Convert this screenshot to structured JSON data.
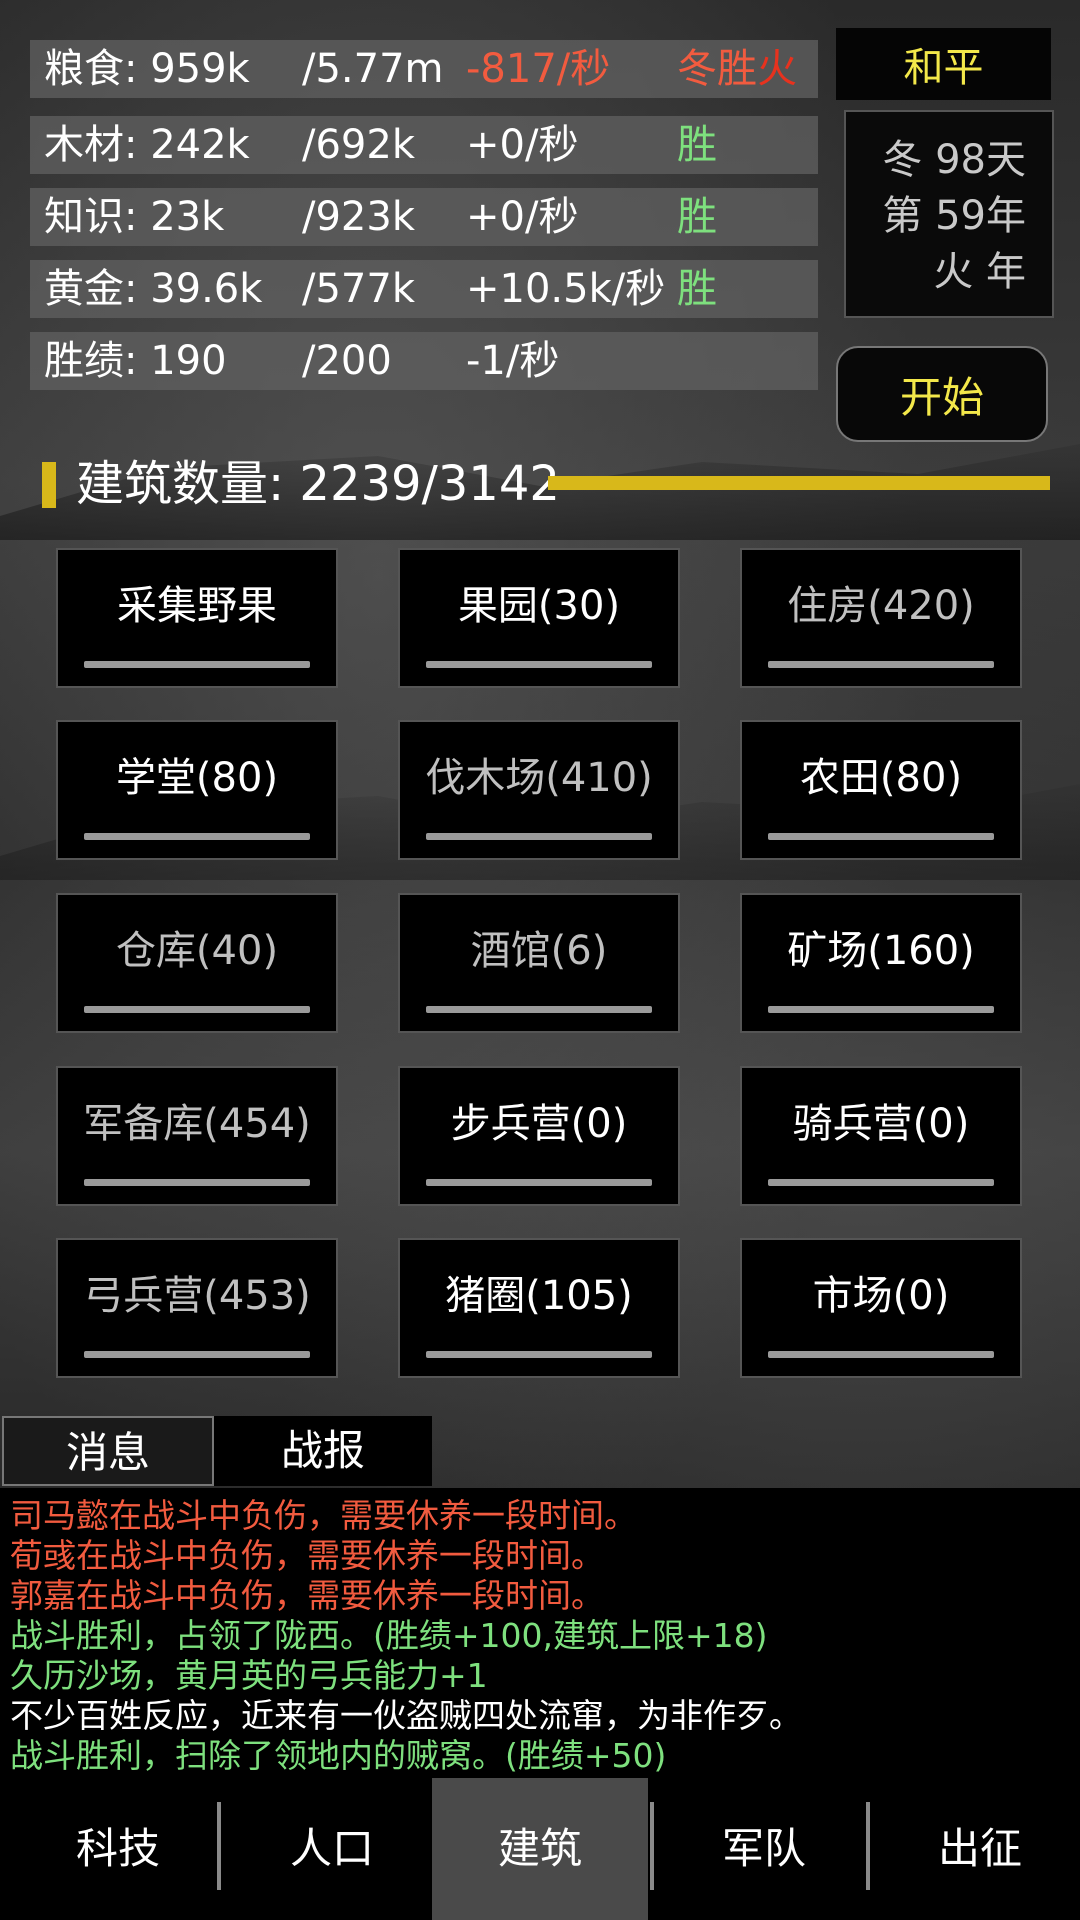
{
  "colors": {
    "red": "#f25b3f",
    "green": "#7ee07e",
    "yellow": "#f3e84a",
    "white": "#ffffff",
    "gray": "#c0c0c0"
  },
  "resources": [
    {
      "name": "粮食: 959k",
      "max": "/5.77m",
      "rate": "-817/秒",
      "tag": "冬胜",
      "tag_extra": "火"
    },
    {
      "name": "木材: 242k",
      "max": "/692k",
      "rate": "+0/秒",
      "tag": "胜",
      "tag_extra": ""
    },
    {
      "name": "知识: 23k",
      "max": "/923k",
      "rate": "+0/秒",
      "tag": "胜",
      "tag_extra": ""
    },
    {
      "name": "黄金: 39.6k",
      "max": "/577k",
      "rate": "+10.5k/秒",
      "tag": "胜",
      "tag_extra": ""
    },
    {
      "name": "胜绩: 190",
      "max": "/200",
      "rate": "-1/秒",
      "tag": "",
      "tag_extra": ""
    }
  ],
  "status": {
    "peace": "和平",
    "season_day": "冬 98天",
    "year": "第 59年",
    "element_year": "火 年",
    "start_button": "开始"
  },
  "buildings_header": {
    "title": "建筑数量: 2239/3142"
  },
  "buildings": [
    {
      "label": "采集野果",
      "enabled": true
    },
    {
      "label": "果园(30)",
      "enabled": true
    },
    {
      "label": "住房(420)",
      "enabled": false
    },
    {
      "label": "学堂(80)",
      "enabled": true
    },
    {
      "label": "伐木场(410)",
      "enabled": false
    },
    {
      "label": "农田(80)",
      "enabled": true
    },
    {
      "label": "仓库(40)",
      "enabled": false
    },
    {
      "label": "酒馆(6)",
      "enabled": false
    },
    {
      "label": "矿场(160)",
      "enabled": true
    },
    {
      "label": "军备库(454)",
      "enabled": false
    },
    {
      "label": "步兵营(0)",
      "enabled": true
    },
    {
      "label": "骑兵营(0)",
      "enabled": true
    },
    {
      "label": "弓兵营(453)",
      "enabled": false
    },
    {
      "label": "猪圈(105)",
      "enabled": true
    },
    {
      "label": "市场(0)",
      "enabled": true
    }
  ],
  "message_tabs": {
    "messages": "消息",
    "battle_report": "战报"
  },
  "log": [
    {
      "text": "司马懿在战斗中负伤，需要休养一段时间。",
      "color": "red"
    },
    {
      "text": "荀彧在战斗中负伤，需要休养一段时间。",
      "color": "red"
    },
    {
      "text": "郭嘉在战斗中负伤，需要休养一段时间。",
      "color": "red"
    },
    {
      "text": "战斗胜利，占领了陇西。(胜绩+100,建筑上限+18)",
      "color": "green"
    },
    {
      "text": "久历沙场，黄月英的弓兵能力+1",
      "color": "green"
    },
    {
      "text": "不少百姓反应，近来有一伙盗贼四处流窜，为非作歹。",
      "color": "white"
    },
    {
      "text": "战斗胜利，扫除了领地内的贼窝。(胜绩+50)",
      "color": "green"
    }
  ],
  "nav": [
    {
      "label": "科技",
      "active": false
    },
    {
      "label": "人口",
      "active": false
    },
    {
      "label": "建筑",
      "active": true
    },
    {
      "label": "军队",
      "active": false
    },
    {
      "label": "出征",
      "active": false
    }
  ]
}
